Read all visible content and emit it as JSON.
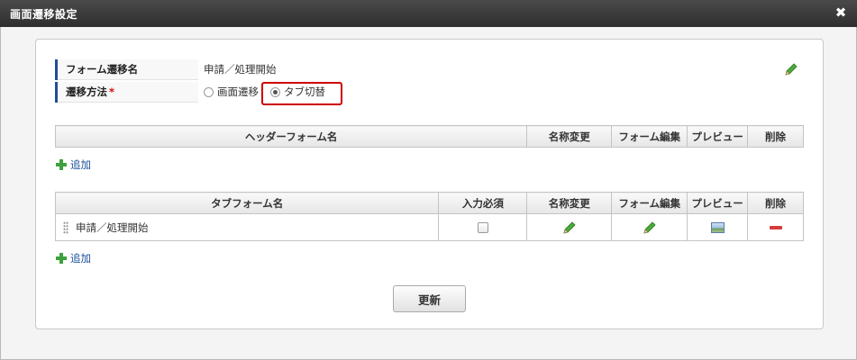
{
  "dialog": {
    "title": "画面遷移設定",
    "close_glyph": "✖"
  },
  "props": {
    "form_name_label": "フォーム遷移名",
    "form_name_value": "申請／処理開始",
    "method_label": "遷移方法",
    "required_mark": "*",
    "method_options": [
      {
        "label": "画面遷移",
        "checked": false
      },
      {
        "label": "タブ切替",
        "checked": true
      }
    ]
  },
  "header_table": {
    "columns": [
      "ヘッダーフォーム名",
      "名称変更",
      "フォーム編集",
      "プレビュー",
      "削除"
    ],
    "rows": []
  },
  "add_label": "追加",
  "tab_table": {
    "columns": [
      "タブフォーム名",
      "入力必須",
      "名称変更",
      "フォーム編集",
      "プレビュー",
      "削除"
    ],
    "rows": [
      {
        "name": "申請／処理開始",
        "required": false
      }
    ]
  },
  "update_button": "更新",
  "colors": {
    "accent_bar": "#1f4e96",
    "highlight": "#cc0000",
    "add_green": "#3da23d",
    "delete_red": "#d23c3c"
  },
  "icons": [
    "close-icon",
    "pencil-icon",
    "plus-icon",
    "drag-handle-icon",
    "preview-icon",
    "minus-icon"
  ]
}
